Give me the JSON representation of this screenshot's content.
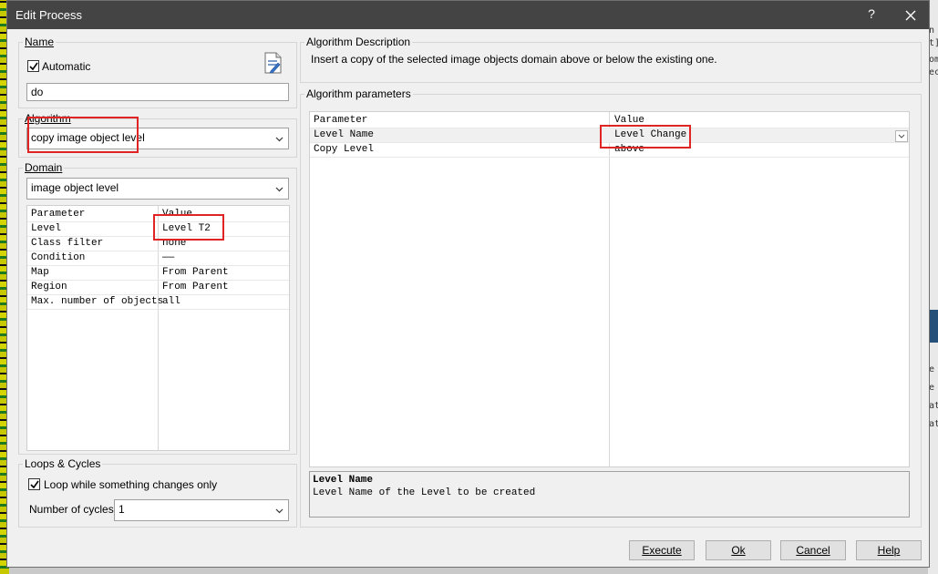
{
  "dialog": {
    "title": "Edit Process",
    "help_glyph": "?",
    "close_glyph": "✕"
  },
  "name_group": {
    "legend": "Name",
    "automatic_label": "Automatic",
    "automatic_checked": true,
    "name_value": "do",
    "edit_icon": "edit-document-icon"
  },
  "algorithm_group": {
    "legend": "Algorithm",
    "selected": "copy image object level"
  },
  "domain_group": {
    "legend": "Domain",
    "selected": "image object level",
    "headers": {
      "param": "Parameter",
      "value": "Value"
    },
    "rows": [
      {
        "param": "Level",
        "value": "Level T2"
      },
      {
        "param": "Class filter",
        "value": "none"
      },
      {
        "param": "Condition",
        "value": "——"
      },
      {
        "param": "Map",
        "value": "From Parent"
      },
      {
        "param": "Region",
        "value": "From Parent"
      },
      {
        "param": "Max. number of objects",
        "value": "all"
      }
    ]
  },
  "loops_group": {
    "legend": "Loops & Cycles",
    "loop_label": "Loop while something changes only",
    "loop_checked": true,
    "cycles_label": "Number of cycles",
    "cycles_value": "1"
  },
  "algo_description": {
    "legend": "Algorithm Description",
    "text": "Insert a copy of the selected image objects domain above or below the existing one."
  },
  "algo_params": {
    "legend": "Algorithm parameters",
    "headers": {
      "param": "Parameter",
      "value": "Value"
    },
    "rows": [
      {
        "param": "Level Name",
        "value": "Level Change"
      },
      {
        "param": "Copy Level",
        "value": "above"
      }
    ],
    "help_title": "Level Name",
    "help_text": "Level Name of the Level to be created"
  },
  "buttons": {
    "execute": "Execute",
    "ok": "Ok",
    "cancel": "Cancel",
    "help": "Help"
  },
  "background_fragments": [
    "n",
    "t]",
    "om",
    "ec",
    "e",
    "e",
    "at",
    "at"
  ],
  "colors": {
    "titlebar": "#444444",
    "highlight": "#e02424",
    "dialog": "#f0f0f0"
  }
}
